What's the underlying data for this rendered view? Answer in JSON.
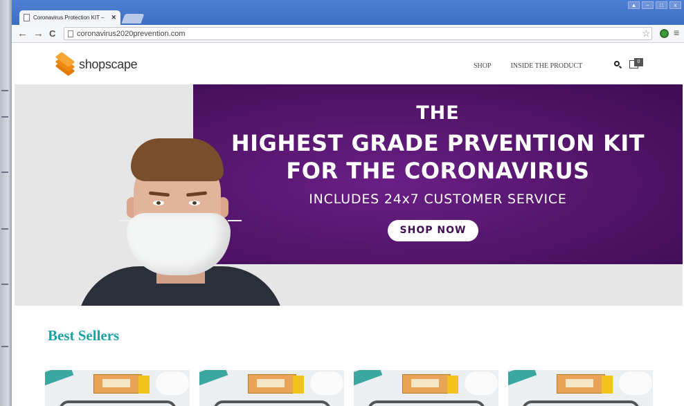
{
  "browser": {
    "tab_title": "Coronavirus Protection KIT –",
    "tab_close": "✕",
    "url": "coronavirus2020prevention.com",
    "nav_back": "←",
    "nav_forward": "→",
    "nav_reload": "C",
    "star": "☆",
    "menu": "≡",
    "window_controls": [
      "▲",
      "–",
      "□",
      "x"
    ]
  },
  "site": {
    "logo_text": "shopscape",
    "nav": [
      "SHOP",
      "INSIDE THE PRODUCT"
    ],
    "cart_count": "0"
  },
  "hero": {
    "line0": "THE",
    "line1": "HIGHEST GRADE PRVENTION KIT",
    "line2": "FOR THE CORONAVIRUS",
    "subtitle": "INCLUDES 24x7 CUSTOMER SERVICE",
    "cta": "SHOP NOW"
  },
  "best_sellers": {
    "heading": "Best Sellers"
  },
  "colors": {
    "hero_purple": "#521468",
    "accent_teal": "#1aa3a3",
    "logo_orange": "#f39a1f"
  },
  "icons": [
    "page-icon",
    "close-icon",
    "back-arrow-icon",
    "forward-arrow-icon",
    "reload-icon",
    "star-icon",
    "extension-icon",
    "menu-icon",
    "search-icon",
    "cart-icon"
  ]
}
